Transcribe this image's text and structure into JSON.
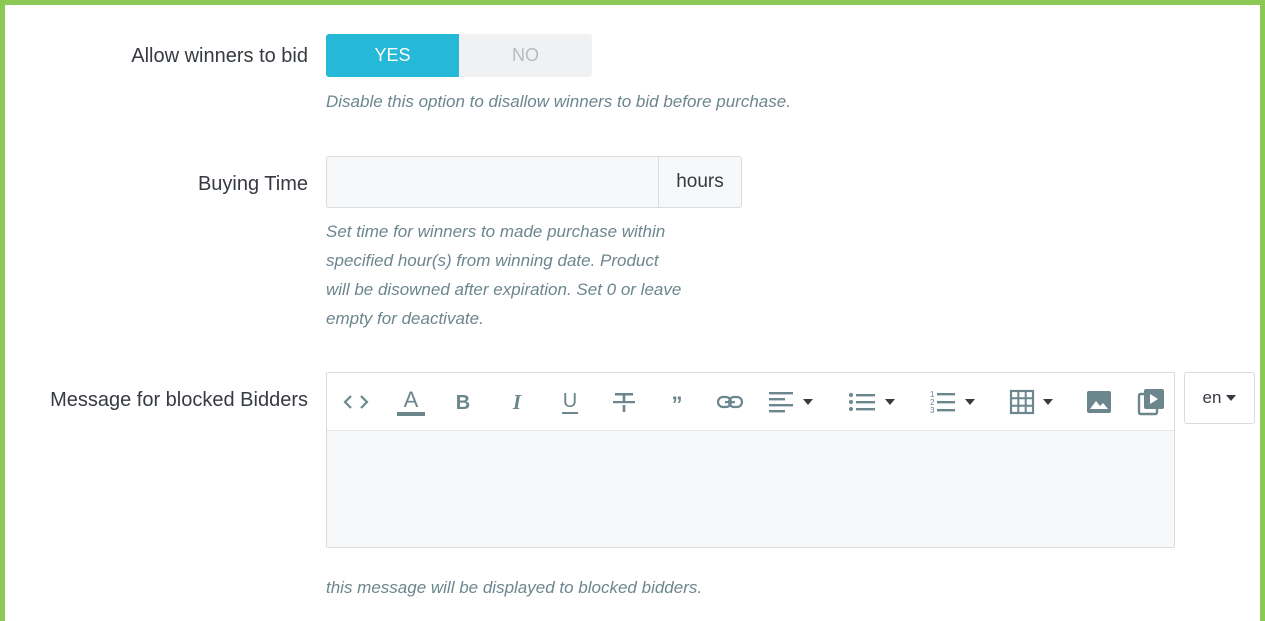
{
  "fields": {
    "allow_winners": {
      "label": "Allow winners to bid",
      "yes": "YES",
      "no": "NO",
      "selected": "YES",
      "help": "Disable this option to disallow winners to bid before purchase."
    },
    "buying_time": {
      "label": "Buying Time",
      "value": "",
      "addon": "hours",
      "help_lines": [
        "Set time for winners to made purchase within",
        "specified hour(s) from winning date. Product",
        "will be disowned after expiration. Set 0 or leave",
        "empty for deactivate."
      ]
    },
    "blocked_message": {
      "label": "Message for blocked Bidders",
      "toolbar": [
        "code-view-icon",
        "font-color-icon",
        "bold-icon",
        "italic-icon",
        "underline-icon",
        "strikethrough-icon",
        "blockquote-icon",
        "link-icon",
        "align-icon",
        "bullet-list-icon",
        "numbered-list-icon",
        "table-icon",
        "image-icon",
        "video-icon"
      ],
      "content": "",
      "language": "en",
      "help": "this message will be displayed to blocked bidders."
    }
  },
  "colors": {
    "frame": "#8bc954",
    "switch_on": "#25b9d7",
    "switch_off": "#eff1f2",
    "help_text": "#6c868e"
  }
}
